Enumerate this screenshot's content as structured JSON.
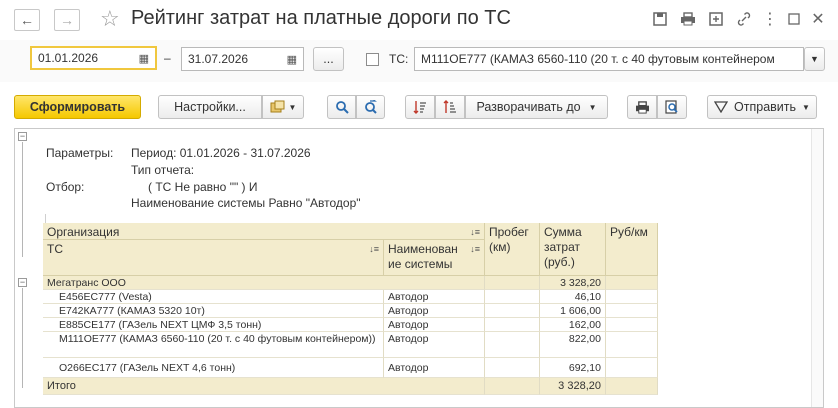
{
  "window": {
    "title": "Рейтинг затрат на платные дороги по ТС"
  },
  "filter": {
    "date_from": "01.01.2026",
    "dash": "–",
    "date_to": "31.07.2026",
    "more": "...",
    "ts_label": "ТС:",
    "ts_value": "М111ОЕ777 (КАМАЗ 6560-110 (20 т. с 40 футовым контейнером"
  },
  "toolbar": {
    "generate": "Сформировать",
    "settings": "Настройки...",
    "expand": "Разворачивать до",
    "send": "Отправить"
  },
  "report": {
    "params_label": "Параметры:",
    "period": "Период: 01.01.2026 - 31.07.2026",
    "report_type": "Тип отчета:",
    "filter_label": "Отбор:",
    "filter_line1": "( ТС Не равно \"\" ) И",
    "filter_line2": "Наименование системы Равно \"Автодор\"",
    "columns": {
      "org": "Организация",
      "ts": "ТС",
      "system": "Наименован ие системы",
      "mileage": "Пробег (км)",
      "cost": "Сумма затрат (руб.)",
      "rub_km": "Руб/км"
    },
    "group": {
      "name": "Мегатранс ООО",
      "cost": "3 328,20"
    },
    "rows": [
      {
        "ts": "Е456ЕС777 (Vesta)",
        "system": "Автодор",
        "cost": "46,10"
      },
      {
        "ts": "Е742КА777 (КАМАЗ 5320 10т)",
        "system": "Автодор",
        "cost": "1 606,00"
      },
      {
        "ts": "Е885СЕ177 (ГАЗель NEXT ЦМФ 3,5 тонн)",
        "system": "Автодор",
        "cost": "162,00"
      },
      {
        "ts": "М111ОЕ777 (КАМАЗ 6560-110 (20 т. с 40 футовым контейнером))",
        "system": "Автодор",
        "cost": "822,00"
      },
      {
        "ts": "О266ЕС177 (ГАЗель NEXT 4,6 тонн)",
        "system": "Автодор",
        "cost": "692,10"
      }
    ],
    "total": {
      "label": "Итого",
      "cost": "3 328,20"
    }
  },
  "icons": [
    "back-icon",
    "forward-icon",
    "star-icon",
    "save-icon",
    "print-icon",
    "attach-icon",
    "link-icon",
    "more-icon",
    "window-icon",
    "close-icon",
    "calendar-icon",
    "search-icon",
    "find-next-icon",
    "sort-icon",
    "dropdown-icon"
  ]
}
